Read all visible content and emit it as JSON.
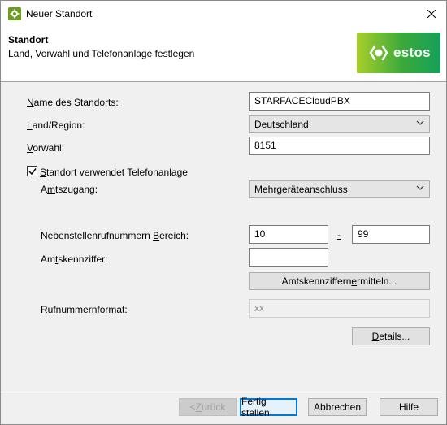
{
  "window": {
    "title": "Neuer Standort",
    "close_glyph": "✕"
  },
  "header": {
    "title": "Standort",
    "subtitle": "Land, Vorwahl und Telefonanlage festlegen",
    "logo_text": "estos"
  },
  "form": {
    "location_name": {
      "label_mnemonic": "N",
      "label_rest": "ame des Standorts:",
      "value": "STARFACECloudPBX"
    },
    "country": {
      "label_mnemonic": "L",
      "label_rest": "and/Region:",
      "value": "Deutschland"
    },
    "area_code": {
      "label_mnemonic": "V",
      "label_rest": "orwahl:",
      "value": "8151"
    },
    "uses_pbx": {
      "label_mnemonic": "S",
      "label_rest": "tandort verwendet Telefonanlage",
      "checked": true
    },
    "line_access": {
      "label_pre": "A",
      "label_mnemonic": "m",
      "label_rest": "tszugang:",
      "value": "Mehrgeräteanschluss"
    },
    "extension_range": {
      "label_pre": "Nebenstellenrufnummern ",
      "label_mnemonic": "B",
      "label_rest": "ereich:",
      "from": "10",
      "separator": "-",
      "to": "99"
    },
    "outside_line_digit": {
      "label_pre": "Am",
      "label_mnemonic": "t",
      "label_rest": "skennziffer:",
      "value": ""
    },
    "detect_button": {
      "label_pre": "Amtskennziffern ",
      "label_mnemonic": "e",
      "label_rest": "rmitteln..."
    },
    "number_format": {
      "label_mnemonic": "R",
      "label_rest": "ufnummernformat:",
      "placeholder": "xx"
    },
    "details_button": {
      "label_mnemonic": "D",
      "label_rest": "etails..."
    }
  },
  "footer": {
    "back": {
      "label_pre": "< ",
      "label_mnemonic": "Z",
      "label_rest": "urück"
    },
    "finish": "Fertig stellen",
    "cancel": "Abbrechen",
    "help": "Hilfe"
  },
  "colors": {
    "accent": "#0078d7",
    "app_icon": "#6b9e1f",
    "logo_gradient": [
      "#a8cf2a",
      "#3aa93b",
      "#16a05a"
    ]
  },
  "icons": {
    "app": "gear-icon",
    "close": "close-icon",
    "dropdown": "chevron-down-icon",
    "check": "check-icon"
  }
}
